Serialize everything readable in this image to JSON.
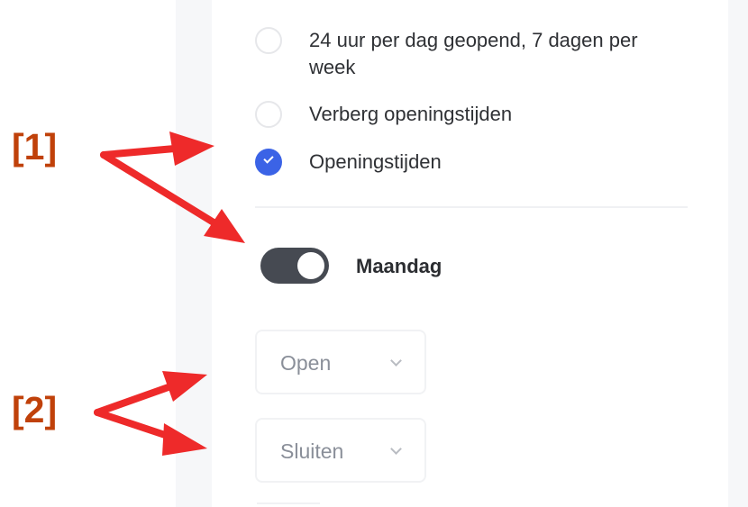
{
  "radio_options": [
    {
      "label": "24 uur per dag geopend, 7 dagen per week",
      "checked": false
    },
    {
      "label": "Verberg openingstijden",
      "checked": false
    },
    {
      "label": "Openingstijden",
      "checked": true
    }
  ],
  "day_toggle": {
    "label": "Maandag",
    "on": true
  },
  "open_select": {
    "value": "Open"
  },
  "close_select": {
    "value": "Sluiten"
  },
  "annotations": {
    "marker_1": "[1]",
    "marker_2": "[2]"
  },
  "colors": {
    "accent": "#3b63e6",
    "annotation": "#c0410a",
    "arrow": "#ee2a2a",
    "toggle": "#464a52"
  },
  "icons": {
    "chevron": "chevron-down-icon",
    "check": "checkmark-icon"
  }
}
